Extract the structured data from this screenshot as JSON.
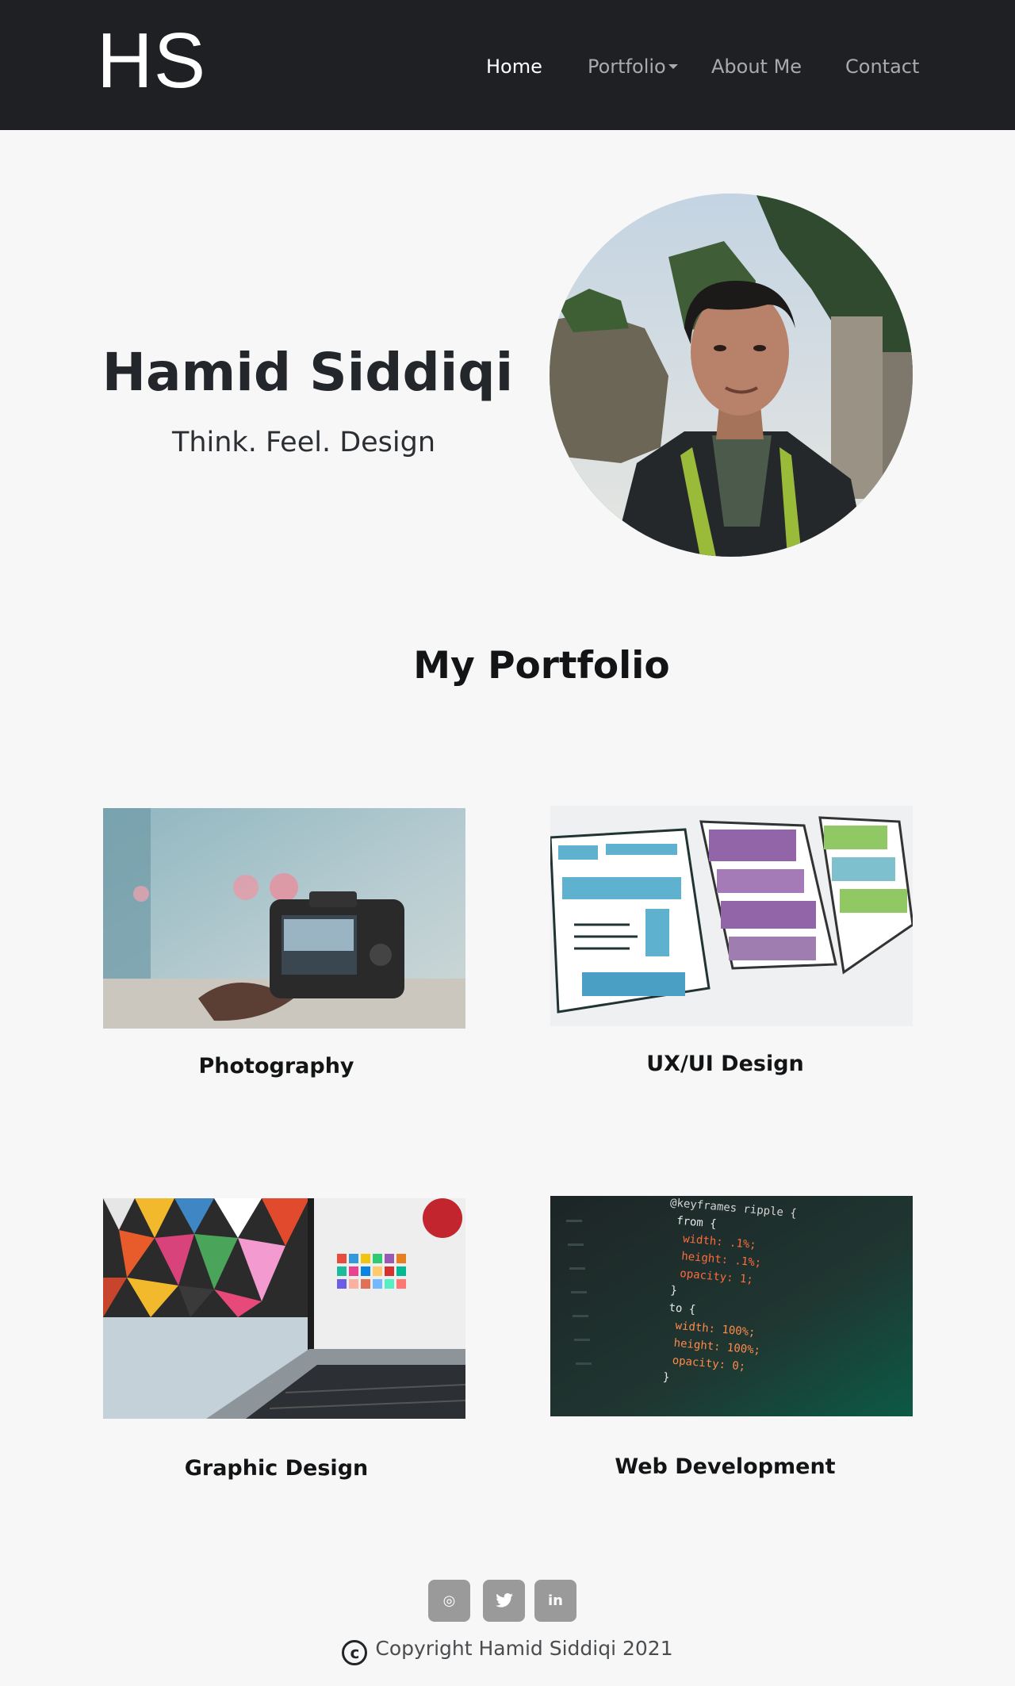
{
  "nav": {
    "logo": "HS",
    "items": [
      {
        "label": "Home"
      },
      {
        "label": "Portfolio"
      },
      {
        "label": "About Me"
      },
      {
        "label": "Contact"
      }
    ]
  },
  "hero": {
    "name": "Hamid Siddiqi",
    "tagline": "Think. Feel. Design"
  },
  "portfolio": {
    "title": "My Portfolio",
    "cards": [
      {
        "label": "Photography"
      },
      {
        "label": "UX/UI Design"
      },
      {
        "label": "Graphic Design"
      },
      {
        "label": "Web Development"
      }
    ],
    "code_lines": [
      "@keyframes ripple {",
      "from {",
      "width: .1%;",
      "height: .1%;",
      "opacity: 1;",
      "}",
      "to {",
      "width: 100%;",
      "height: 100%;",
      "opacity: 0;",
      "}"
    ]
  },
  "footer": {
    "social": [
      {
        "icon": "instagram-icon",
        "glyph": "◎"
      },
      {
        "icon": "twitter-icon",
        "glyph": "🐦"
      },
      {
        "icon": "linkedin-icon",
        "glyph": "in"
      }
    ],
    "copyright_symbol": "c",
    "copyright": "Copyright Hamid Siddiqi 2021"
  }
}
